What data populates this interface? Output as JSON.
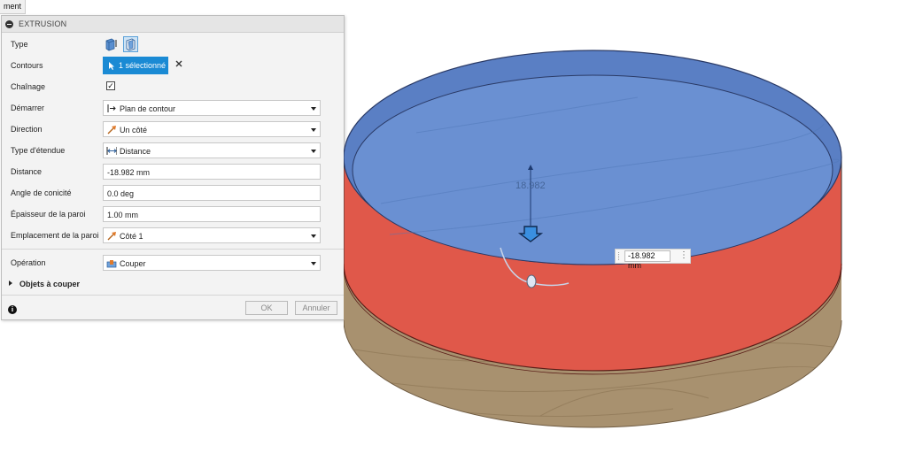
{
  "top_tab": {
    "label": "ment"
  },
  "panel": {
    "title": "EXTRUSION",
    "type": {
      "label": "Type"
    },
    "contours": {
      "label": "Contours",
      "selection": "1 sélectionné"
    },
    "chainage": {
      "label": "Chaînage",
      "checked": true,
      "check_mark": "✓"
    },
    "demarrer": {
      "label": "Démarrer",
      "value": "Plan de contour"
    },
    "direction": {
      "label": "Direction",
      "value": "Un côté"
    },
    "type_etendue": {
      "label": "Type d'étendue",
      "value": "Distance"
    },
    "distance": {
      "label": "Distance",
      "value": "-18.982 mm"
    },
    "angle": {
      "label": "Angle de conicité",
      "value": "0.0 deg"
    },
    "epaisseur": {
      "label": "Épaisseur de la paroi",
      "value": "1.00 mm"
    },
    "emplacement": {
      "label": "Emplacement de la paroi",
      "value": "Côté 1"
    },
    "operation": {
      "label": "Opération",
      "value": "Couper"
    },
    "objets": {
      "label": "Objets à couper"
    },
    "ok_label": "OK",
    "cancel_label": "Annuler",
    "info_symbol": "i"
  },
  "viewport": {
    "dimension_label": "18.982",
    "dimension_input": "-18.982 mm",
    "more_symbol": "⋮",
    "colors": {
      "top_blue": "#5a7fc4",
      "wall_red": "#e0584a",
      "wood": "#a8916f"
    }
  }
}
